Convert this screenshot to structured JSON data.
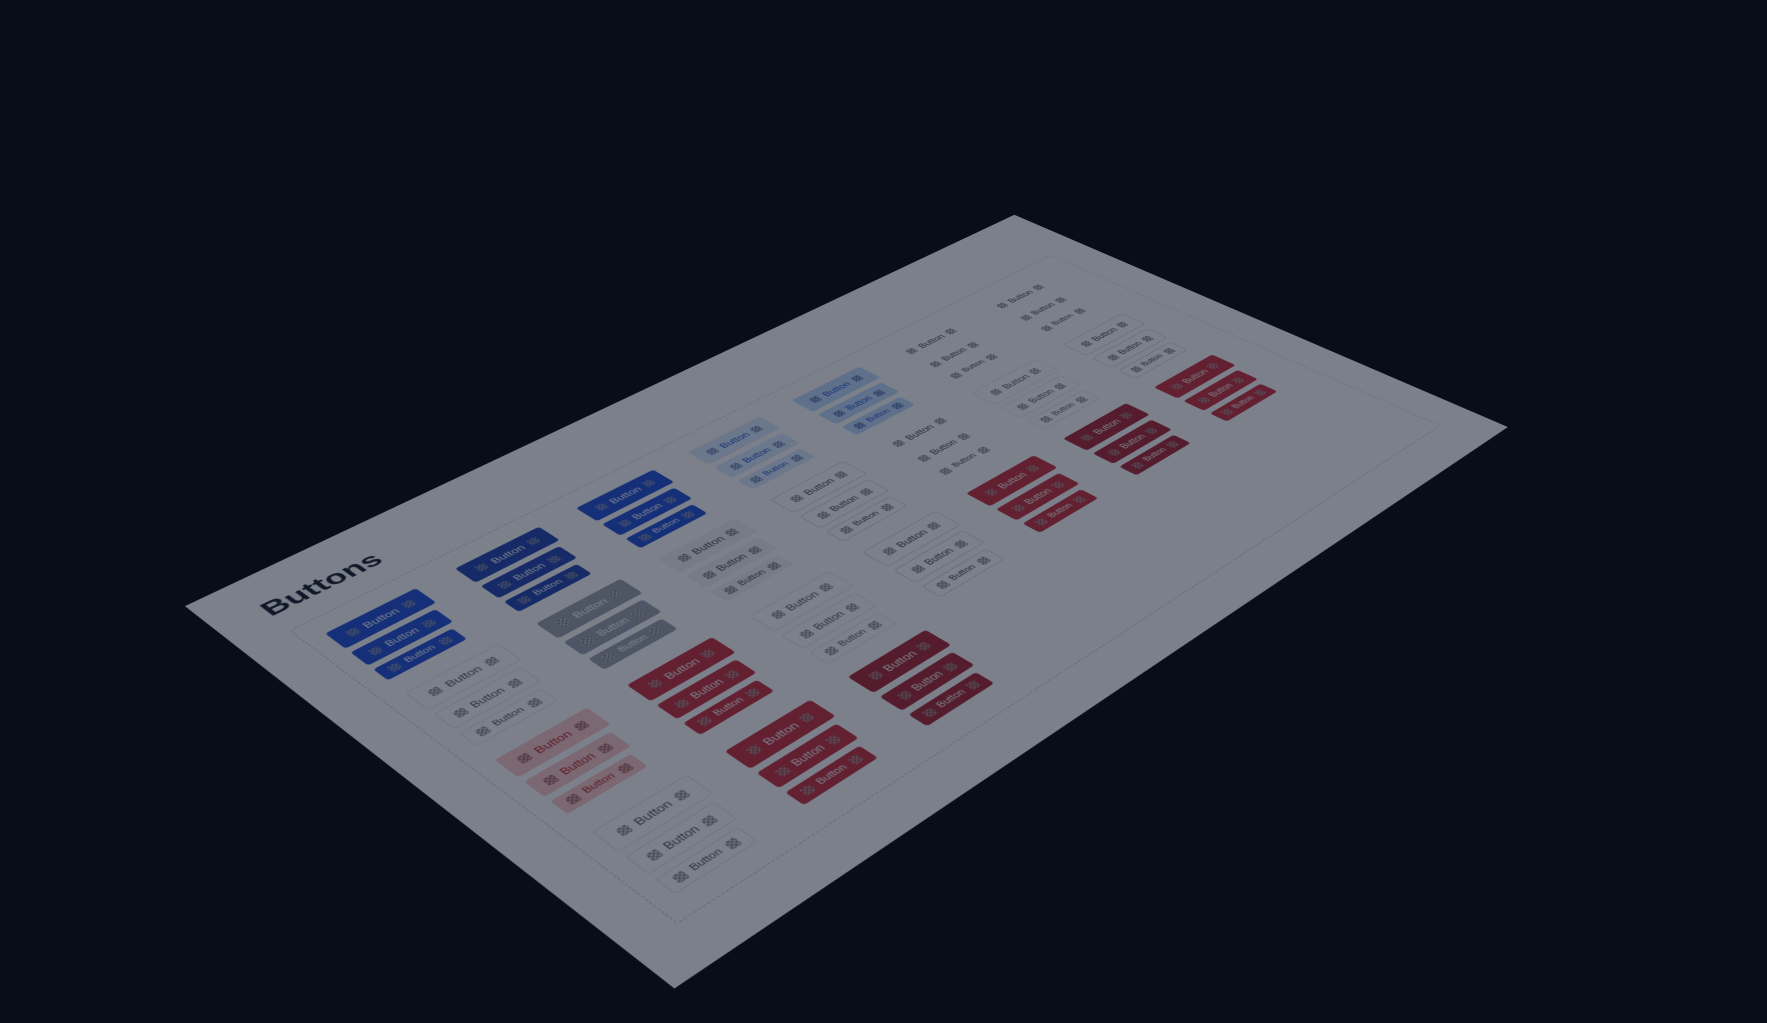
{
  "title": "Buttons",
  "label": "Button",
  "sizes": [
    "l",
    "m",
    "s"
  ],
  "variants": [
    "primary-solid",
    "primary-solid-hover",
    "primary-solid",
    "primary-soft",
    "primary-soft-hover",
    "neutral-ghost",
    "neutral-ghost",
    "neutral-outline",
    "neutral-solid",
    "neutral-soft",
    "neutral-outline-hover",
    "neutral-ghost",
    "neutral-outline",
    "neutral-outline-hover",
    "danger-soft",
    "danger-solid",
    "neutral-outline",
    "neutral-outline-hover",
    "danger-solid",
    "danger-solid-hover",
    "danger-solid",
    "neutral-outline",
    "danger-solid",
    "danger-solid-hover"
  ]
}
